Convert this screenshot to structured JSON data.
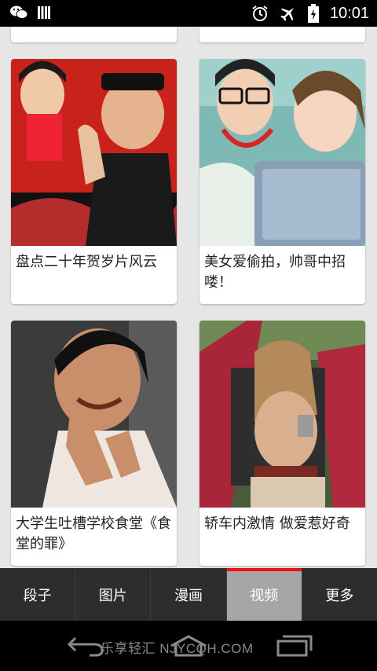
{
  "status_bar": {
    "time": "10:01",
    "icons": [
      "wechat-icon",
      "signal-bars-icon",
      "alarm-icon",
      "airplane-mode-icon",
      "battery-charging-icon"
    ]
  },
  "feed": {
    "items": [
      {
        "caption": "",
        "image": "video-thumbnail"
      },
      {
        "caption": "",
        "image": "video-thumbnail"
      },
      {
        "caption": "盘点二十年贺岁片风云",
        "image": "comedy-film-poster"
      },
      {
        "caption": "美女爱偷拍，帅哥中招喽！",
        "image": "couple-selfie-tablet"
      },
      {
        "caption": "大学生吐槽学校食堂《食堂的罪》",
        "image": "man-expression-portrait"
      },
      {
        "caption": "轿车内激情 做爱惹好奇",
        "image": "car-scene-photo"
      }
    ]
  },
  "tabs": [
    {
      "label": "段子",
      "active": false
    },
    {
      "label": "图片",
      "active": false
    },
    {
      "label": "漫画",
      "active": false
    },
    {
      "label": "视频",
      "active": true
    },
    {
      "label": "更多",
      "active": false
    }
  ],
  "colors": {
    "tab_bar_bg": "#2d2d2d",
    "tab_active_bg": "#a6a6a6",
    "tab_active_indicator": "#e11111"
  },
  "nav_bar": {
    "watermark": "乐享轻汇  NJYCQH.COM",
    "buttons": [
      "back-icon",
      "home-icon",
      "recent-apps-icon"
    ]
  }
}
